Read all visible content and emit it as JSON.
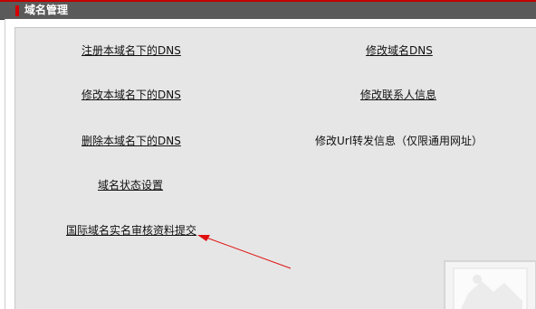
{
  "header": {
    "title": "域名管理"
  },
  "links": {
    "register_dns": "注册本域名下的DNS",
    "modify_domain_dns": "修改域名DNS",
    "modify_local_dns": "修改本域名下的DNS",
    "modify_contact": "修改联系人信息",
    "delete_local_dns": "删除本域名下的DNS",
    "domain_status": "域名状态设置",
    "intl_realname_submit": "国际域名实名审核资料提交"
  },
  "url_forward": {
    "label": "修改Url转发信息（仅限通用网址）"
  },
  "colors": {
    "header_bg": "#5a5a5a",
    "accent_red": "#d40000",
    "panel_bg": "#e6e6e6",
    "arrow": "#e01010"
  }
}
